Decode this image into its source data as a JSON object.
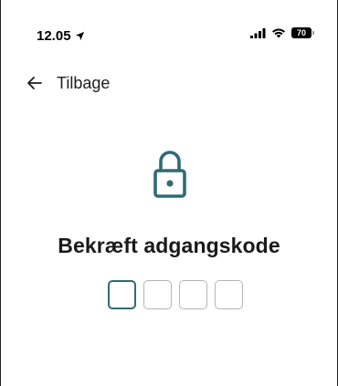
{
  "status_bar": {
    "time": "12.05",
    "battery_level": "70",
    "icons": [
      "location-arrow-icon",
      "signal-icon",
      "wifi-icon",
      "battery-icon"
    ]
  },
  "header": {
    "back_icon": "arrow-left-icon",
    "back_label": "Tilbage"
  },
  "main": {
    "icon": "lock-icon",
    "title": "Bekræft adgangskode",
    "pin_length": 4,
    "pin_entered": 0
  },
  "colors": {
    "accent": "#2f6b75",
    "text": "#1a1a1a",
    "box_border": "#b5b5b5"
  }
}
